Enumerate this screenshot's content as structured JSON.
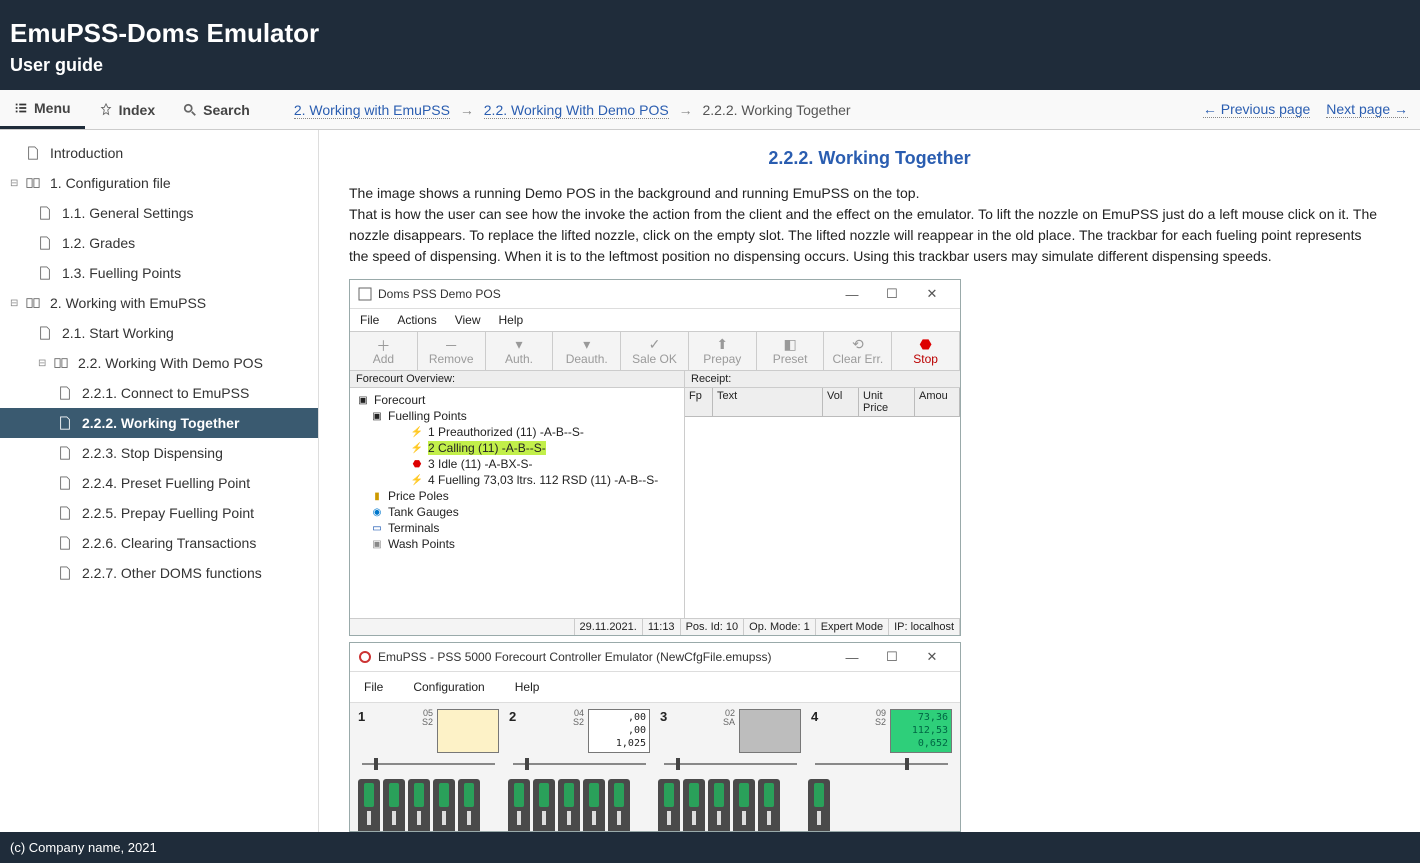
{
  "header": {
    "title": "EmuPSS-Doms Emulator",
    "subtitle": "User guide"
  },
  "tabs": {
    "menu": "Menu",
    "index": "Index",
    "search": "Search"
  },
  "breadcrumbs": {
    "c1": "2. Working with EmuPSS",
    "c2": "2.2. Working With Demo POS",
    "c3": "2.2.2. Working Together"
  },
  "pager": {
    "prev": "← Previous page",
    "next": "Next page →"
  },
  "nav": {
    "intro": "Introduction",
    "s1": "1. Configuration file",
    "s1_1": "1.1. General Settings",
    "s1_2": "1.2. Grades",
    "s1_3": "1.3. Fuelling Points",
    "s2": "2. Working with EmuPSS",
    "s2_1": "2.1. Start Working",
    "s2_2": "2.2. Working With Demo POS",
    "s2_2_1": "2.2.1. Connect to EmuPSS",
    "s2_2_2": "2.2.2. Working Together",
    "s2_2_3": "2.2.3. Stop Dispensing",
    "s2_2_4": "2.2.4. Preset Fuelling Point",
    "s2_2_5": "2.2.5. Prepay Fuelling Point",
    "s2_2_6": "2.2.6. Clearing Transactions",
    "s2_2_7": "2.2.7. Other DOMS functions"
  },
  "page": {
    "title": "2.2.2. Working Together",
    "p1": "The image shows a running Demo POS in the background and running EmuPSS on the top.",
    "p2": "That is how the user can see how the invoke the action from the client and the effect on the emulator. To lift the nozzle on EmuPSS just do a left mouse click on it. The nozzle disappears. To replace the lifted nozzle, click on the empty slot. The lifted nozzle will reappear in the old place. The trackbar for each fueling point represents the speed of dispensing. When it is to the leftmost position no dispensing occurs. Using this trackbar users may simulate different dispensing speeds."
  },
  "pos": {
    "title": "Doms PSS Demo POS",
    "menu": {
      "file": "File",
      "actions": "Actions",
      "view": "View",
      "help": "Help"
    },
    "toolbar": {
      "add": "Add",
      "remove": "Remove",
      "auth": "Auth.",
      "deauth": "Deauth.",
      "saleok": "Sale OK",
      "prepay": "Prepay",
      "preset": "Preset",
      "clearerr": "Clear Err.",
      "stop": "Stop"
    },
    "overviewLabel": "Forecourt Overview:",
    "receiptLabel": "Receipt:",
    "tree": {
      "root": "Forecourt",
      "fp": "Fuelling Points",
      "r1": "1   Preauthorized (11) -A-B--S-",
      "r2": "2   Calling (11) -A-B--S-",
      "r3": "3   Idle (11) -A-BX-S-",
      "r4": "4   Fuelling 73,03 ltrs. 112 RSD (11) -A-B--S-",
      "pp": "Price Poles",
      "tg": "Tank Gauges",
      "tm": "Terminals",
      "wp": "Wash Points"
    },
    "grid": {
      "fp": "Fp",
      "text": "Text",
      "vol": "Vol",
      "unitprice": "Unit Price",
      "amount": "Amou"
    },
    "status": {
      "date": "29.11.2021.",
      "time": "11:13",
      "posid": "Pos. Id:  10",
      "opmode": "Op. Mode:  1",
      "expert": "Expert Mode",
      "ip": "IP: localhost"
    }
  },
  "emu": {
    "title": "EmuPSS - PSS 5000 Forecourt Controller Emulator (NewCfgFile.emupss)",
    "menu": {
      "file": "File",
      "config": "Configuration",
      "help": "Help"
    },
    "fp": [
      {
        "num": "1",
        "code": "05\nS2",
        "disp": "yellow",
        "lines": [
          "",
          "",
          ""
        ],
        "handle": 12
      },
      {
        "num": "2",
        "code": "04\nS2",
        "disp": "white",
        "lines": [
          ",00",
          ",00",
          "1,025"
        ],
        "handle": 12
      },
      {
        "num": "3",
        "code": "02\nSA",
        "disp": "grey",
        "lines": [
          "",
          "",
          ""
        ],
        "handle": 12
      },
      {
        "num": "4",
        "code": "09\nS2",
        "disp": "green",
        "lines": [
          "73,36",
          "112,53",
          "0,652"
        ],
        "handle": 90
      }
    ]
  },
  "footer": "(c) Company name, 2021"
}
